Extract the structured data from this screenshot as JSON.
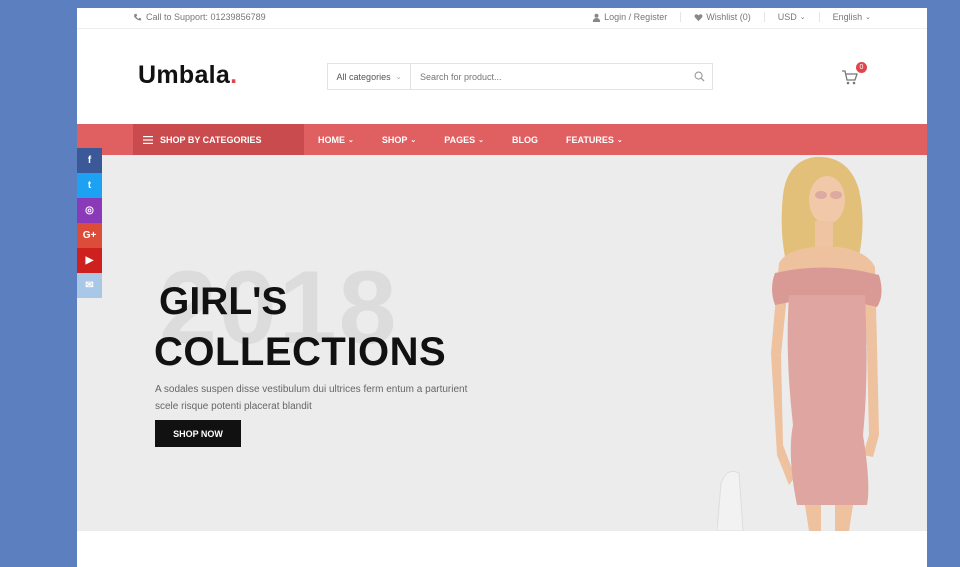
{
  "topbar": {
    "support": "Call to Support: 01239856789",
    "login": "Login / Register",
    "wishlist": "Wishlist (0)",
    "currency": "USD",
    "language": "English"
  },
  "header": {
    "logo_text": "Umbala",
    "logo_dot": ".",
    "category_select": "All categories",
    "search_placeholder": "Search for product...",
    "cart_count": "0"
  },
  "nav": {
    "shop_by_categories": "SHOP BY CATEGORIES",
    "items": [
      "HOME",
      "SHOP",
      "PAGES",
      "BLOG",
      "FEATURES"
    ]
  },
  "hero": {
    "year": "2018",
    "title_line1": "GIRL'S",
    "title_line2": "COLLECTIONS",
    "description": "A sodales suspen disse vestibulum dui ultrices ferm entum a parturient scele risque potenti placerat blandit",
    "button": "SHOP NOW"
  },
  "social": [
    {
      "name": "facebook",
      "glyph": "f",
      "color": "#3b5998"
    },
    {
      "name": "twitter",
      "glyph": "t",
      "color": "#1da1f2"
    },
    {
      "name": "instagram",
      "glyph": "◎",
      "color": "#8a3ab9"
    },
    {
      "name": "google-plus",
      "glyph": "G+",
      "color": "#dd4b39"
    },
    {
      "name": "youtube",
      "glyph": "▶",
      "color": "#cd201f"
    },
    {
      "name": "other",
      "glyph": "✉",
      "color": "#a9c8e8"
    }
  ]
}
